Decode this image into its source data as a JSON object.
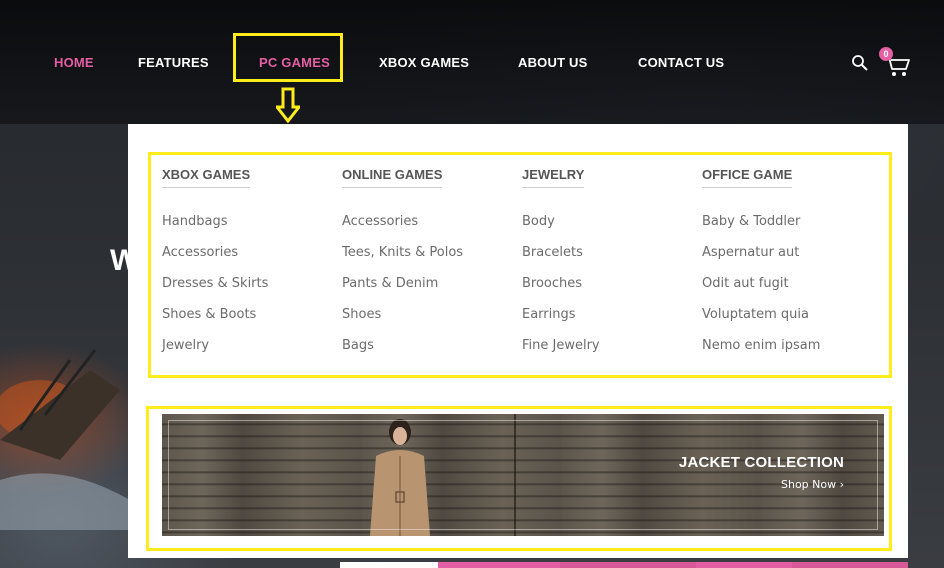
{
  "nav": {
    "items": [
      {
        "label": "HOME"
      },
      {
        "label": "FEATURES"
      },
      {
        "label": "PC GAMES"
      },
      {
        "label": "XBOX GAMES"
      },
      {
        "label": "ABOUT US"
      },
      {
        "label": "CONTACT US"
      }
    ],
    "cart_count": "0"
  },
  "hero": {
    "partial_heading": "W"
  },
  "mega_menu": {
    "columns": [
      {
        "heading": "XBOX GAMES",
        "links": [
          "Handbags",
          "Accessories",
          "Dresses & Skirts",
          "Shoes & Boots",
          "Jewelry"
        ]
      },
      {
        "heading": "ONLINE GAMES",
        "links": [
          "Accessories",
          "Tees, Knits & Polos",
          "Pants & Denim",
          "Shoes",
          "Bags"
        ]
      },
      {
        "heading": "JEWELRY",
        "links": [
          "Body",
          "Bracelets",
          "Brooches",
          "Earrings",
          "Fine Jewelry"
        ]
      },
      {
        "heading": "OFFICE GAME",
        "links": [
          "Baby & Toddler",
          "Aspernatur aut",
          "Odit aut fugit",
          "Voluptatem quia",
          "Nemo enim ipsam"
        ]
      }
    ],
    "banner": {
      "title": "JACKET COLLECTION",
      "link": "Shop Now ›"
    }
  },
  "colors": {
    "accent": "#e45fa3",
    "highlight": "#ffec1a"
  },
  "icons": [
    "search-icon",
    "cart-icon",
    "arrow-down-icon"
  ]
}
